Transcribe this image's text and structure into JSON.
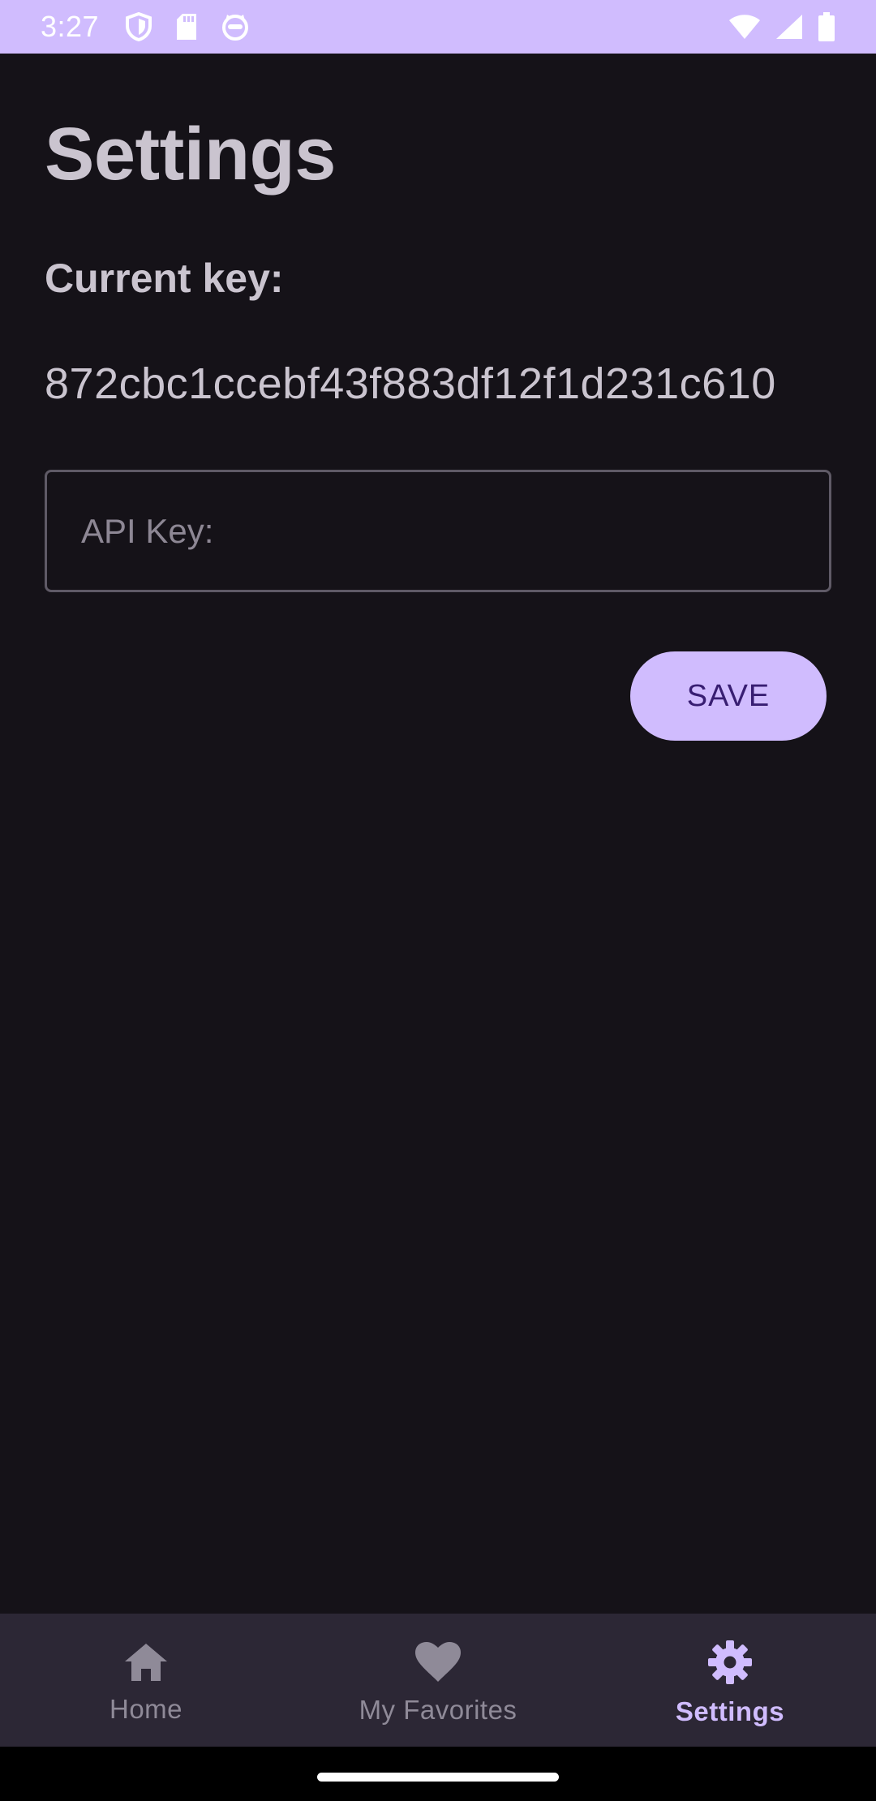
{
  "status_bar": {
    "time": "3:27",
    "left_icons": [
      "shield-icon",
      "sd-card-icon",
      "cat-face-icon"
    ],
    "right_icons": [
      "wifi-icon",
      "signal-icon",
      "battery-icon"
    ]
  },
  "page": {
    "title": "Settings",
    "current_key_label": "Current key:",
    "current_key_value": "872cbc1ccebf43f883df12f1d231c610"
  },
  "api_input": {
    "placeholder": "API Key:",
    "value": ""
  },
  "save_button": {
    "label": "SAVE"
  },
  "bottom_nav": {
    "items": [
      {
        "label": "Home",
        "icon": "home-icon",
        "active": false
      },
      {
        "label": "My Favorites",
        "icon": "heart-icon",
        "active": false
      },
      {
        "label": "Settings",
        "icon": "gear-icon",
        "active": true
      }
    ]
  },
  "colors": {
    "background": "#151218",
    "accent": "#d0bcfe",
    "on_accent": "#381e72",
    "text": "#cac4cf",
    "nav_background": "#2c2735",
    "nav_inactive": "#8f8a98"
  }
}
